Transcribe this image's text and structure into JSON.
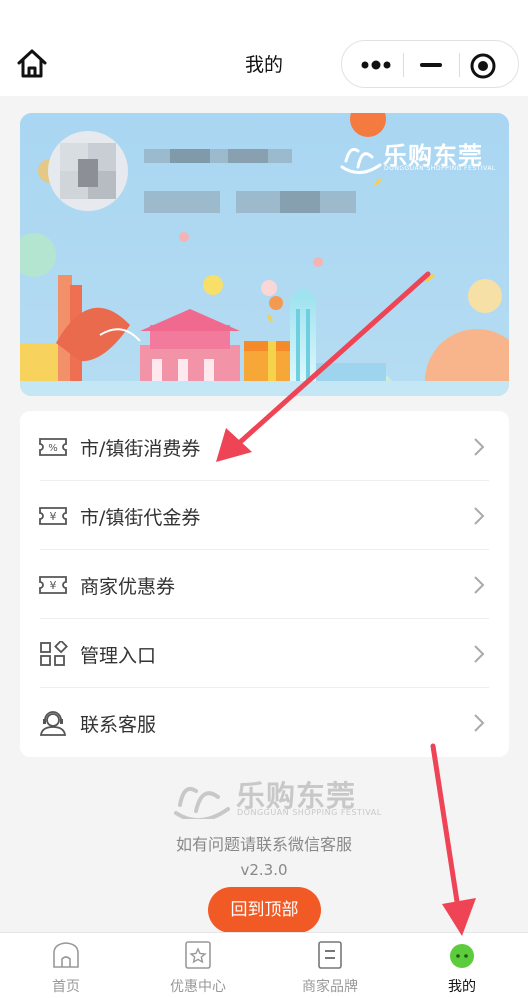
{
  "navbar": {
    "title": "我的",
    "home_icon": "home-icon",
    "more_icon": "more-dots-icon",
    "minimize_icon": "minimize-icon",
    "close_icon": "target-close-icon"
  },
  "banner": {
    "brand_name": "乐购东莞",
    "brand_subtitle": "DONGGUAN SHOPPING FESTIVAL"
  },
  "menu": {
    "items": [
      {
        "label": "市/镇街消费券",
        "icon": "percent-ticket-icon"
      },
      {
        "label": "市/镇街代金券",
        "icon": "yuan-ticket-icon"
      },
      {
        "label": "商家优惠券",
        "icon": "yuan-ticket-icon"
      },
      {
        "label": "管理入口",
        "icon": "grid-apps-icon"
      },
      {
        "label": "联系客服",
        "icon": "customer-service-icon"
      }
    ]
  },
  "footer": {
    "brand_name": "乐购东莞",
    "brand_subtitle": "DONGGUAN SHOPPING FESTIVAL",
    "contact_text": "如有问题请联系微信客服",
    "version": "v2.3.0",
    "back_to_top": "回到顶部"
  },
  "tabbar": {
    "tabs": [
      {
        "label": "首页",
        "icon": "home-outline-icon",
        "active": false
      },
      {
        "label": "优惠中心",
        "icon": "star-card-icon",
        "active": false
      },
      {
        "label": "商家品牌",
        "icon": "list-doc-icon",
        "active": false
      },
      {
        "label": "我的",
        "icon": "green-face-icon",
        "active": true
      }
    ]
  },
  "colors": {
    "accent": "#f15a24",
    "banner_bg": "#a8d7f0",
    "annotation": "#ee4455",
    "active_tab_icon": "#5ccc3c"
  }
}
